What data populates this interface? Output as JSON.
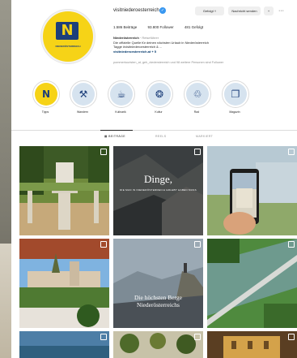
{
  "profile": {
    "username": "visitniederoesterreich",
    "follow_label": "Gefolgt ˅",
    "message_label": "Nachricht senden",
    "add_label": "+",
    "more_label": "···",
    "avatar_text": "N",
    "avatar_subtext": "NIEDERÖSTERREICH",
    "stats": {
      "posts": "1.586 Beiträge",
      "followers": "93.800 Follower",
      "following": "481 Gefolgt"
    },
    "bio": {
      "name": "Niederösterreich",
      "category": "Reiseführer",
      "line1": "Die offizielle Quelle für deinen nächsten Urlaub in Niederösterreich",
      "line2": "Tagge #visitniederoesterreich & ...",
      "link": "visitniederoesterreich.at + 5"
    },
    "followed_by": "pommertouristen_at, geh_niedersterreich und 98 weitere Personen sind Follower"
  },
  "highlights": [
    {
      "label": "Tipps",
      "glyph": "N"
    },
    {
      "label": "Wandern",
      "glyph": "⚒"
    },
    {
      "label": "Kulinarik",
      "glyph": "☕"
    },
    {
      "label": "Kultur",
      "glyph": "❂"
    },
    {
      "label": "Rad",
      "glyph": "♲"
    },
    {
      "label": "Magazin",
      "glyph": "❐"
    }
  ],
  "tabs": [
    {
      "label": "▦ BEITRÄGE"
    },
    {
      "label": "REELS"
    },
    {
      "label": "MARKIERT"
    }
  ],
  "grid": {
    "tile2_title": "Dinge,",
    "tile2_subtitle": "DIE MAN IN NIEDERÖSTERREICH ERLEBT HABEN MUSS",
    "tile5_title": "Die höchsten Berge Niederösterreichs"
  },
  "colors": {
    "brand_yellow": "#f6d317",
    "brand_blue": "#1d3f7a",
    "verified_blue": "#3897f0"
  }
}
